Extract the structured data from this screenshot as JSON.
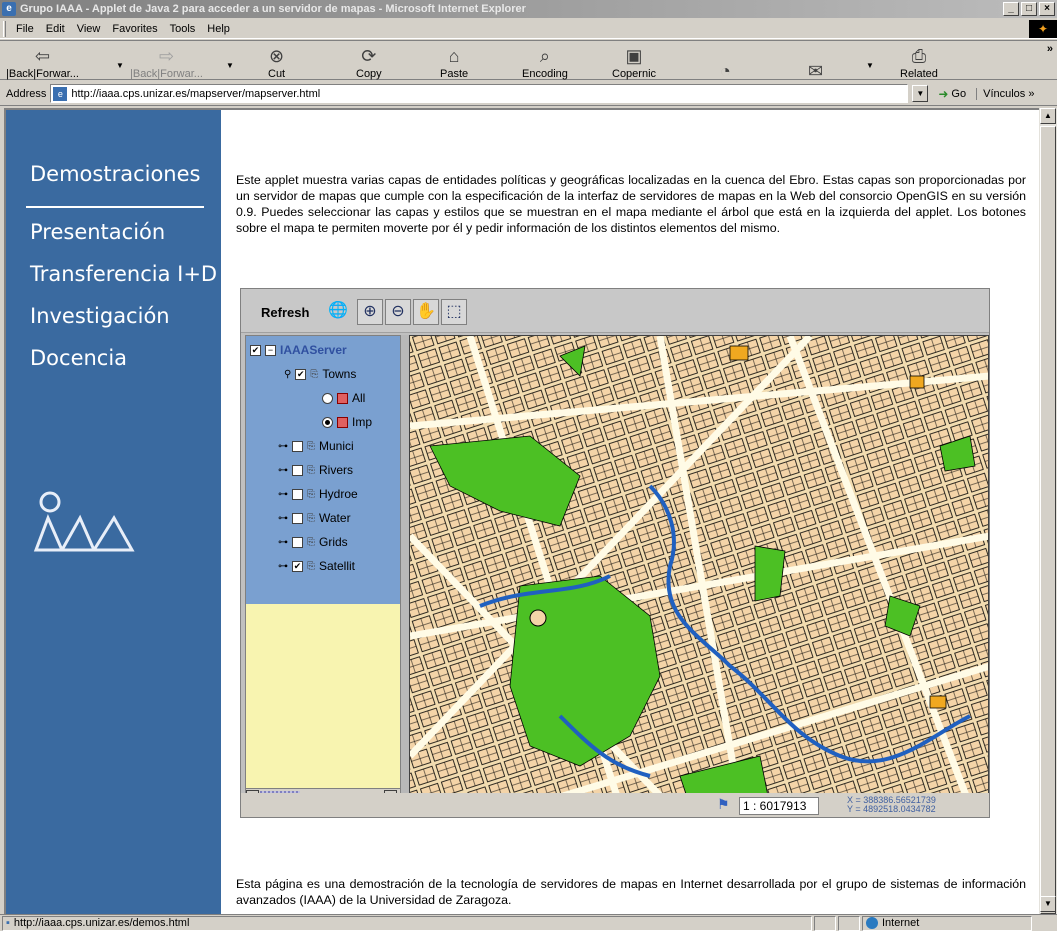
{
  "window": {
    "title": "Grupo IAAA - Applet de Java 2 para acceder a un servidor de mapas - Microsoft Internet Explorer",
    "buttons": [
      "_",
      "□",
      "×"
    ]
  },
  "menu": [
    "File",
    "Edit",
    "View",
    "Favorites",
    "Tools",
    "Help"
  ],
  "toolbar": {
    "back": "|Back|Forwar...",
    "forward": "|Back|Forwar...",
    "stop": "Cut",
    "refresh": "Copy",
    "home": "Paste",
    "search": "Encoding",
    "favorites": "Copernic",
    "print": "Related"
  },
  "address": {
    "label": "Address",
    "url": "http://iaaa.cps.unizar.es/mapserver/mapserver.html",
    "go": "Go",
    "links": "Vínculos"
  },
  "nav": {
    "heading": "Demostraciones",
    "items": [
      "Presentación",
      "Transferencia I+D",
      "Investigación",
      "Docencia"
    ]
  },
  "intro_text": "Este applet muestra varias capas de entidades políticas y geográficas localizadas en la cuenca del Ebro. Estas capas son proporcionadas por un servidor de mapas que cumple con la especificación de la interfaz de servidores de mapas en la Web del consorcio OpenGIS en su versión 0.9. Puedes seleccionar las capas y estilos que se muestran en el mapa mediante el árbol que está en la izquierda del applet. Los botones sobre el mapa te permiten moverte por él y pedir información de los distintos elementos del mismo.",
  "applet": {
    "refresh": "Refresh",
    "server": "IAAAServer",
    "layers": [
      {
        "name": "Towns",
        "checked": true
      },
      {
        "name": "All",
        "style": true,
        "selected": false
      },
      {
        "name": "Imp",
        "style": true,
        "selected": true
      },
      {
        "name": "Munici",
        "checked": false
      },
      {
        "name": "Rivers",
        "checked": false
      },
      {
        "name": "Hydroe",
        "checked": false
      },
      {
        "name": "Water",
        "checked": false
      },
      {
        "name": "Grids",
        "checked": false
      },
      {
        "name": "Satellit",
        "checked": true
      }
    ],
    "scale": "1 : 6017913",
    "coord_x": "X = 388386.56521739",
    "coord_y": "Y = 4892518.0434782"
  },
  "footer_text": "Esta página es una demostración de la tecnología de servidores de mapas en Internet desarrollada por el grupo de sistemas de información avanzados (IAAA) de la Universidad de Zaragoza.",
  "status": {
    "url": "http://iaaa.cps.unizar.es/demos.html",
    "zone": "Internet"
  }
}
